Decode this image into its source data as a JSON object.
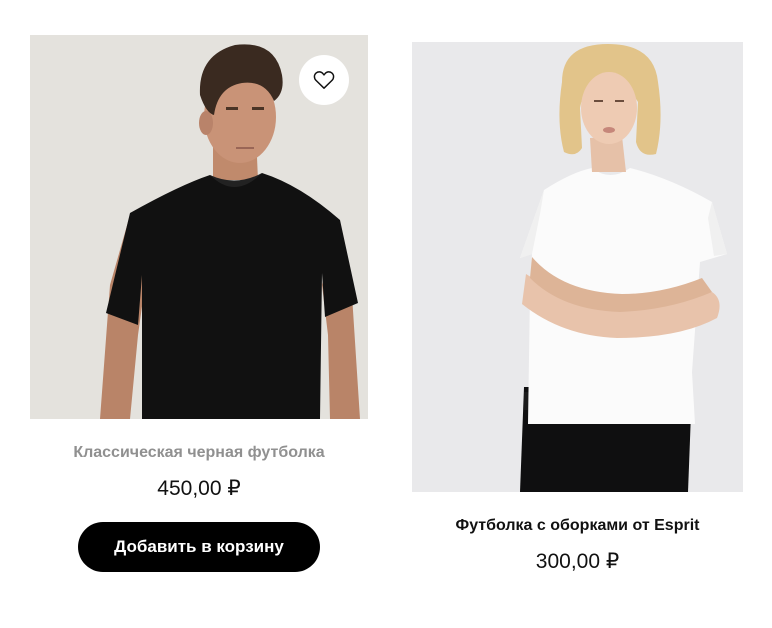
{
  "products": [
    {
      "title": "Классическая черная футболка",
      "price": "450,00 ₽",
      "add_to_cart_label": "Добавить в корзину",
      "wishlist_icon": "heart-outline-icon",
      "image_alt": "man-in-black-tshirt"
    },
    {
      "title": "Футболка с оборками от Esprit",
      "price": "300,00 ₽",
      "image_alt": "woman-in-white-tshirt"
    }
  ],
  "colors": {
    "button_bg": "#000000",
    "button_text": "#ffffff",
    "muted_title": "#909090",
    "text": "#111111"
  }
}
